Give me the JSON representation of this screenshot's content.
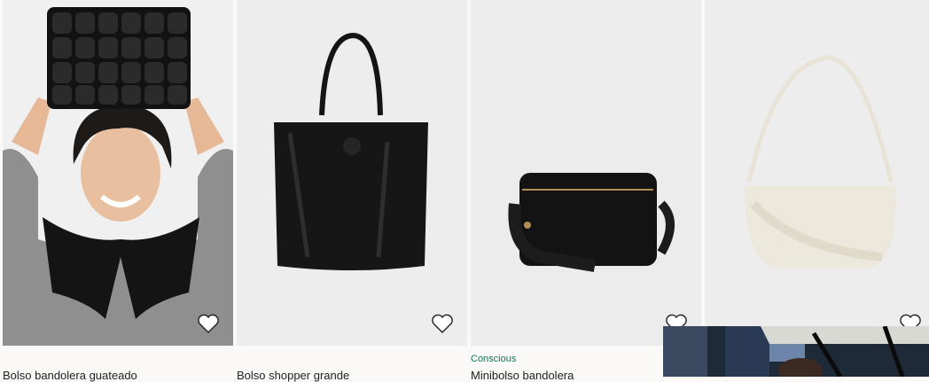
{
  "products": [
    {
      "title": "Bolso bandolera guateado",
      "tag": "",
      "favorite_icon": "heart-outline-icon"
    },
    {
      "title": "Bolso shopper grande",
      "tag": "",
      "favorite_icon": "heart-outline-icon"
    },
    {
      "title": "Minibolso bandolera",
      "tag": "Conscious",
      "favorite_icon": "heart-outline-icon"
    },
    {
      "title": "",
      "tag": "",
      "favorite_icon": "heart-outline-icon"
    }
  ],
  "colors": {
    "background": "#faf9f8",
    "image_bg": "#ececec",
    "conscious_tag": "#0f7a5a",
    "text": "#222222"
  }
}
